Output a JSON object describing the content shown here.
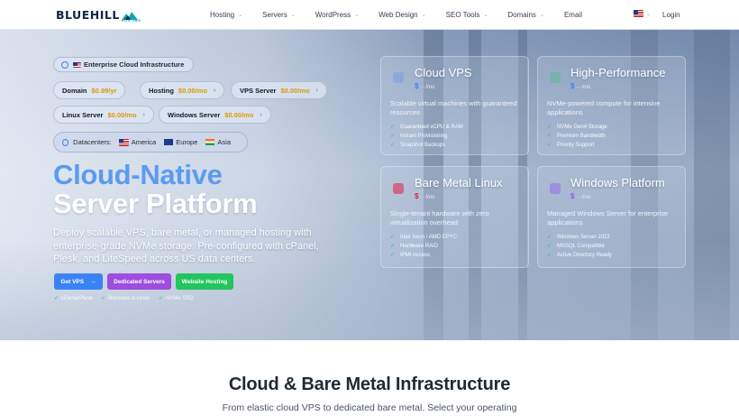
{
  "logo": {
    "name": "BLUEHILL",
    "sub": "HOSTING"
  },
  "nav": {
    "items": [
      {
        "label": "Hosting",
        "dropdown": true
      },
      {
        "label": "Servers",
        "dropdown": true
      },
      {
        "label": "WordPress",
        "dropdown": true
      },
      {
        "label": "Web Design",
        "dropdown": true
      },
      {
        "label": "SEO Tools",
        "dropdown": true
      },
      {
        "label": "Domains",
        "dropdown": true
      },
      {
        "label": "Email",
        "dropdown": false
      }
    ],
    "language_flag": "us-flag-icon",
    "login": "Login"
  },
  "hero": {
    "badge": "Enterprise Cloud Infrastructure",
    "pills": [
      {
        "name": "Domain",
        "price": "$0.99/yr"
      },
      {
        "name": "Hosting",
        "price": "$0.00/mo"
      },
      {
        "name": "VPS Server",
        "price": "$0.00/mo"
      },
      {
        "name": "Linux Server",
        "price": "$0.00/mo"
      },
      {
        "name": "Windows Server",
        "price": "$0.00/mo"
      }
    ],
    "datacenters": {
      "label": "Datacenters:",
      "regions": [
        "America",
        "Europe",
        "Asia"
      ]
    },
    "title_line1": "Cloud-Native",
    "title_line2": "Server Platform",
    "lead": "Deploy scalable VPS, bare metal, or managed hosting with enterprise-grade NVMe storage. Pre-configured with cPanel, Plesk, and LiteSpeed across US data centers.",
    "buttons": {
      "vps": "Get VPS",
      "dedicated": "Dedicated Servers",
      "website": "Website Hosting"
    },
    "checks": [
      "cPanel/Plesk",
      "Windows & Linux",
      "NVMe SSD"
    ]
  },
  "cards": [
    {
      "title": "Cloud VPS",
      "price_symbol": "$",
      "price_unit": "/mo",
      "desc": "Scalable virtual machines with guaranteed resources",
      "features": [
        "Guaranteed vCPU & RAM",
        "Instant Provisioning",
        "Snapshot Backups"
      ],
      "icon_color": "#3b82f6"
    },
    {
      "title": "High-Performance",
      "price_symbol": "$",
      "price_unit": "/mo",
      "desc": "NVMe-powered compute for intensive applications",
      "features": [
        "NVMe Gen4 Storage",
        "Premium Bandwidth",
        "Priority Support"
      ],
      "icon_color": "#22c55e"
    },
    {
      "title": "Bare Metal Linux",
      "price_symbol": "$",
      "price_unit": "/mo",
      "desc": "Single-tenant hardware with zero virtualization overhead",
      "features": [
        "Intel Xeon / AMD EPYC",
        "Hardware RAID",
        "IPMI Access"
      ],
      "icon_color": "#e11d48"
    },
    {
      "title": "Windows Platform",
      "price_symbol": "$",
      "price_unit": "/mo",
      "desc": "Managed Windows Server for enterprise applications",
      "features": [
        "Windows Server 2022",
        "MSSQL Compatible",
        "Active Directory Ready"
      ],
      "icon_color": "#8b5cf6"
    }
  ],
  "section": {
    "title": "Cloud & Bare Metal Infrastructure",
    "subtitle": "From elastic cloud VPS to dedicated bare metal. Select your operating"
  }
}
